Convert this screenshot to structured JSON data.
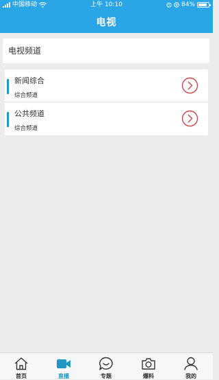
{
  "status_bar": {
    "carrier": "中国移动",
    "time": "上午 10:10",
    "battery": "84%",
    "battery_level": 0.84
  },
  "header": {
    "title": "电视"
  },
  "section": {
    "label": "电视频道"
  },
  "channels": [
    {
      "name": "新闻综合",
      "subtitle": "综合频道"
    },
    {
      "name": "公共频道",
      "subtitle": "综合频道"
    }
  ],
  "tabbar": {
    "items": [
      {
        "label": "首页",
        "icon": "home-icon"
      },
      {
        "label": "直播",
        "icon": "video-camera-icon",
        "active": true
      },
      {
        "label": "专题",
        "icon": "chat-bubble-icon"
      },
      {
        "label": "爆料",
        "icon": "camera-icon"
      },
      {
        "label": "我的",
        "icon": "user-icon"
      }
    ]
  },
  "colors": {
    "header": "#2aa6e6",
    "accent": "#1e97c4",
    "arrow": "#c9484b",
    "background": "#ececec"
  }
}
